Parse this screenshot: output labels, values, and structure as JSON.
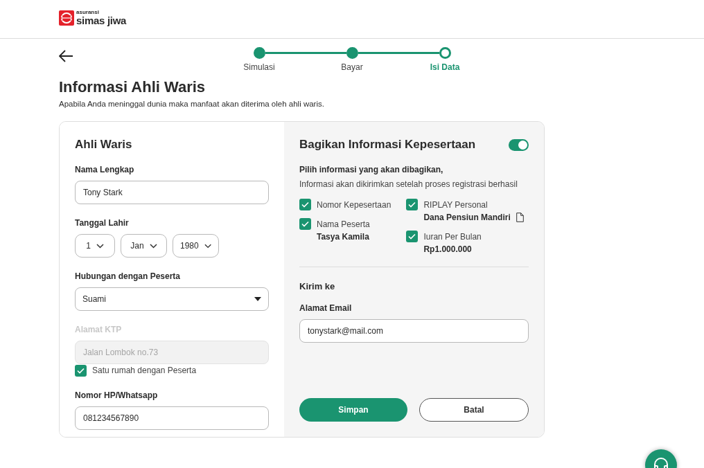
{
  "header": {
    "logo_small": "asuransi",
    "logo_name": "simas jiwa"
  },
  "stepper": [
    {
      "label": "Simulasi",
      "completed": true
    },
    {
      "label": "Bayar",
      "completed": true
    },
    {
      "label": "Isi Data",
      "completed": false
    }
  ],
  "page": {
    "title": "Informasi Ahli Waris",
    "subtitle": "Apabila Anda meninggal dunia maka manfaat akan diterima oleh ahli waris."
  },
  "heir_form": {
    "title": "Ahli Waris",
    "fields": [
      {
        "kind": "text",
        "label": "Nama Lengkap",
        "value": "Tony Stark",
        "disabled": false
      },
      {
        "kind": "date",
        "label": "Tanggal Lahir",
        "parts": [
          "1",
          "Jan",
          "1980"
        ]
      },
      {
        "kind": "select",
        "label": "Hubungan dengan Peserta",
        "value": "Suami"
      },
      {
        "kind": "text",
        "label": "Alamat KTP",
        "placeholder": "Jalan Lombok no.73",
        "disabled": true
      },
      {
        "kind": "checkbox",
        "label": "Satu rumah dengan Peserta",
        "checked": true
      },
      {
        "kind": "text",
        "label": "Nomor HP/Whatsapp",
        "value": "081234567890",
        "disabled": false
      }
    ]
  },
  "share": {
    "title": "Bagikan Informasi Kepesertaan",
    "on": true,
    "intro_bold": "Pilih informasi yang akan dibagikan,",
    "intro": "Informasi akan dikirimkan setelah proses registrasi berhasil",
    "option_columns": [
      [
        {
          "label": "Nomor Kepesertaan",
          "checked": true
        },
        {
          "label": "Nama Peserta",
          "value": "Tasya Kamila",
          "checked": true,
          "has_document": false
        }
      ],
      [
        {
          "label": "RIPLAY Personal",
          "value": "Dana Pensiun Mandiri",
          "checked": true,
          "has_document": true
        },
        {
          "label": "Iuran Per Bulan",
          "value": "Rp1.000.000",
          "checked": true,
          "has_document": false
        }
      ]
    ],
    "send_to_title": "Kirim ke",
    "email_label": "Alamat Email",
    "email_value": "tonystark@mail.com",
    "buttons": [
      {
        "label": "Simpan",
        "kind": "primary"
      },
      {
        "label": "Batal",
        "kind": "outline"
      }
    ]
  }
}
